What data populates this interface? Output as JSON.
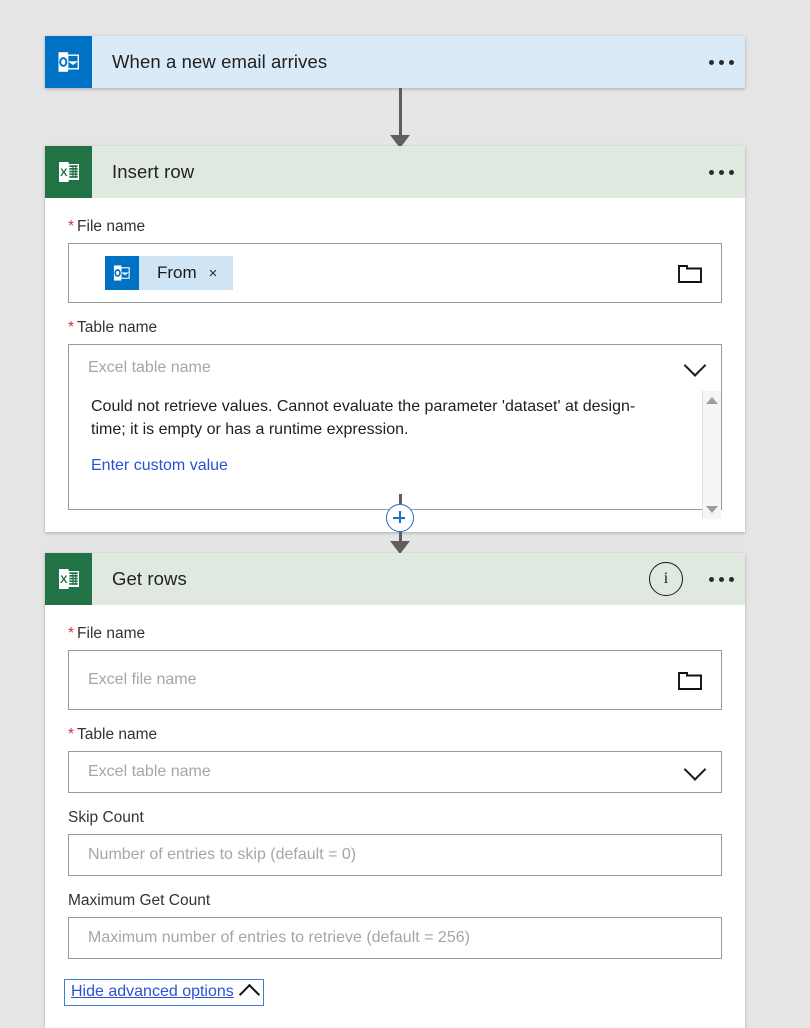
{
  "colors": {
    "canvas_bg": "#e5e5e5",
    "outlook_blue": "#0072c6",
    "excel_green": "#217346",
    "trigger_header_bg": "#dbeaf7",
    "action_header_bg": "#dfe9e0",
    "link_blue": "#2b50d8",
    "required_red": "#d13438",
    "connector_gray": "#605e5c",
    "plus_blue": "#1f6fc4"
  },
  "trigger": {
    "title": "When a new email arrives",
    "app_icon": "outlook-icon",
    "menu_icon": "ellipsis-icon"
  },
  "insert_row": {
    "title": "Insert row",
    "app_icon": "excel-icon",
    "menu_icon": "ellipsis-icon",
    "file_name": {
      "label": "File name",
      "required_marker": "*",
      "token_label": "From",
      "token_icon": "outlook-icon",
      "token_remove": "×",
      "picker_icon": "folder-icon"
    },
    "table_name": {
      "label": "Table name",
      "required_marker": "*",
      "placeholder": "Excel table name",
      "dropdown_icon": "chevron-down-icon",
      "message": "Could not retrieve values. Cannot evaluate the parameter 'dataset' at design-time; it is empty or has a runtime expression.",
      "custom_value_link": "Enter custom value",
      "scroll_up_icon": "scroll-up-arrow-icon",
      "scroll_down_icon": "scroll-down-arrow-icon"
    }
  },
  "get_rows": {
    "title": "Get rows",
    "app_icon": "excel-icon",
    "info_icon": "i",
    "menu_icon": "ellipsis-icon",
    "file_name": {
      "label": "File name",
      "required_marker": "*",
      "placeholder": "Excel file name",
      "picker_icon": "folder-icon"
    },
    "table_name": {
      "label": "Table name",
      "required_marker": "*",
      "placeholder": "Excel table name",
      "dropdown_icon": "chevron-down-icon"
    },
    "skip_count": {
      "label": "Skip Count",
      "placeholder": "Number of entries to skip (default = 0)"
    },
    "max_get_count": {
      "label": "Maximum Get Count",
      "placeholder": "Maximum number of entries to retrieve (default = 256)"
    },
    "advanced_toggle": {
      "label": "Hide advanced options",
      "chevron_icon": "chevron-up-icon"
    }
  },
  "connectors": {
    "add_step_label": "+"
  }
}
